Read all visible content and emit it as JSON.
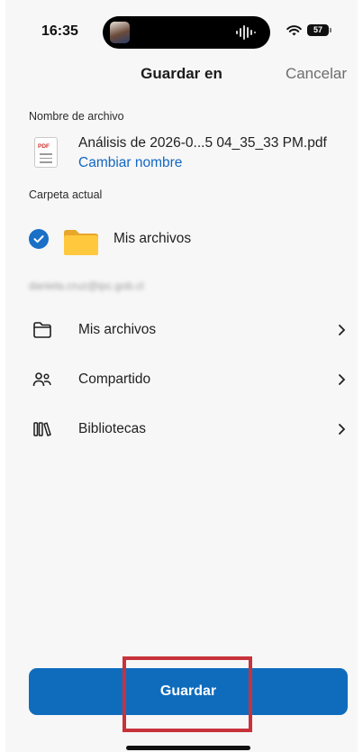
{
  "status_bar": {
    "time": "16:35",
    "battery": "57"
  },
  "nav": {
    "title": "Guardar en",
    "cancel": "Cancelar"
  },
  "file": {
    "section_label": "Nombre de archivo",
    "icon_tag": "PDF",
    "name": "Análisis de 2026-0...5 04_35_33 PM.pdf",
    "rename_link": "Cambiar nombre"
  },
  "current_folder": {
    "section_label": "Carpeta actual",
    "name": "Mis archivos"
  },
  "account": {
    "email": "daniela.cruz@ipc.gob.cl"
  },
  "locations": [
    {
      "label": "Mis archivos",
      "icon": "folder-outline-icon"
    },
    {
      "label": "Compartido",
      "icon": "people-icon"
    },
    {
      "label": "Bibliotecas",
      "icon": "library-icon"
    }
  ],
  "save_button": {
    "label": "Guardar"
  },
  "colors": {
    "accent": "#0f6cbd",
    "link": "#1267c2",
    "highlight": "#c8323a",
    "folder": "#ffc83d"
  }
}
